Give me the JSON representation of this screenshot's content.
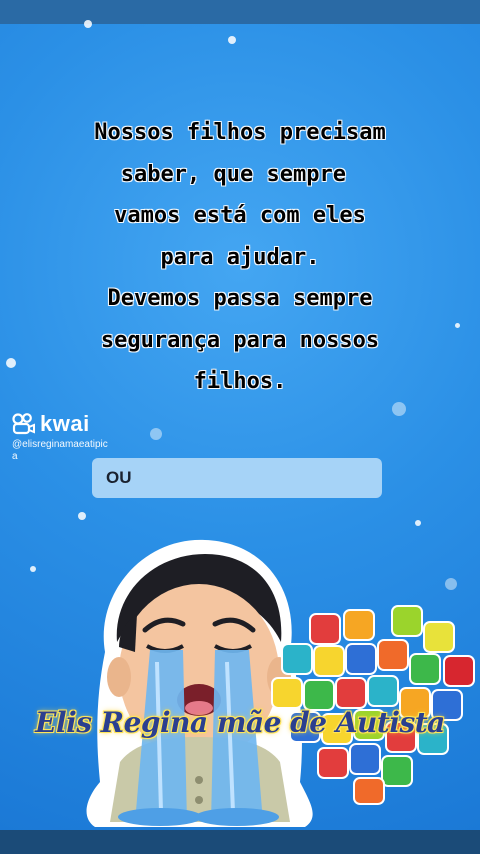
{
  "message": {
    "lines": [
      "Nossos filhos precisam",
      "saber, que sempre ",
      "vamos está com eles",
      "para ajudar.",
      "Devemos passa sempre",
      "segurança para nossos",
      "filhos."
    ]
  },
  "watermark": {
    "brand": "kwai",
    "handle": "@elisreginamaeatipica",
    "icon": "kwai-logo-icon"
  },
  "input": {
    "value": "OU"
  },
  "caption": "Elis Regina mãe de Autista",
  "colors": {
    "background": "#1f8be0",
    "input_bg": "#a6d3f7",
    "caption_fill": "#2b3f8f",
    "caption_glow": "#ffe14d"
  }
}
